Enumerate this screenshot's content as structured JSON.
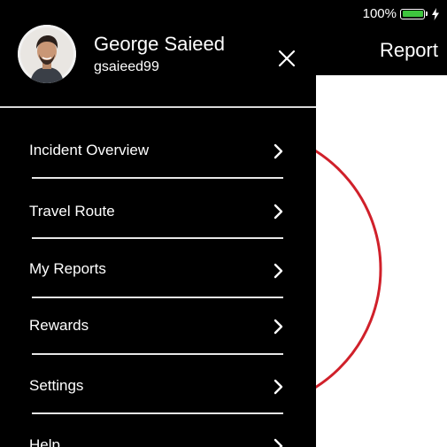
{
  "status_bar": {
    "battery_percent": "100%",
    "battery_level": 1.0,
    "battery_color": "#3ec43e"
  },
  "main": {
    "header_title": "Report",
    "accent_color": "#d0202a"
  },
  "drawer": {
    "user": {
      "name": "George Saieed",
      "handle": "gsaieed99"
    },
    "close_icon": "close-icon",
    "menu": [
      {
        "label": "Incident Overview",
        "icon": "chevron-right-icon"
      },
      {
        "label": "Travel Route",
        "icon": "chevron-right-icon"
      },
      {
        "label": "My Reports",
        "icon": "chevron-right-icon"
      },
      {
        "label": "Rewards",
        "icon": "chevron-right-icon"
      },
      {
        "label": "Settings",
        "icon": "chevron-right-icon"
      },
      {
        "label": "Help",
        "icon": "chevron-right-icon"
      }
    ]
  }
}
